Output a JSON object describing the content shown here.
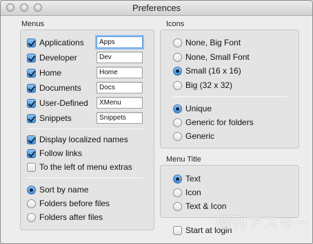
{
  "window": {
    "title": "Preferences"
  },
  "menus": {
    "label": "Menus",
    "items": [
      {
        "label": "Applications",
        "checked": true,
        "value": "Apps",
        "focused": true
      },
      {
        "label": "Developer",
        "checked": true,
        "value": "Dev"
      },
      {
        "label": "Home",
        "checked": true,
        "value": "Home"
      },
      {
        "label": "Documents",
        "checked": true,
        "value": "Docs"
      },
      {
        "label": "User-Defined",
        "checked": true,
        "value": "XMenu"
      },
      {
        "label": "Snippets",
        "checked": true,
        "value": "Snippets"
      }
    ],
    "options": [
      {
        "label": "Display localized names",
        "checked": true
      },
      {
        "label": "Follow links",
        "checked": true
      },
      {
        "label": "To the left of menu extras",
        "checked": false
      }
    ],
    "sort": [
      {
        "label": "Sort by name",
        "selected": true
      },
      {
        "label": "Folders before files",
        "selected": false
      },
      {
        "label": "Folders after files",
        "selected": false
      }
    ]
  },
  "icons": {
    "label": "Icons",
    "size_options": [
      {
        "label": "None, Big Font",
        "selected": false
      },
      {
        "label": "None, Small Font",
        "selected": false
      },
      {
        "label": "Small (16 x 16)",
        "selected": true
      },
      {
        "label": "Big (32 x 32)",
        "selected": false
      }
    ],
    "style_options": [
      {
        "label": "Unique",
        "selected": true
      },
      {
        "label": "Generic for folders",
        "selected": false
      },
      {
        "label": "Generic",
        "selected": false
      }
    ]
  },
  "menu_title": {
    "label": "Menu Title",
    "options": [
      {
        "label": "Text",
        "selected": true
      },
      {
        "label": "Icon",
        "selected": false
      },
      {
        "label": "Text & Icon",
        "selected": false
      }
    ]
  },
  "start_at_login": {
    "label": "Start at login",
    "checked": false
  },
  "watermark": "週刊アスキー"
}
